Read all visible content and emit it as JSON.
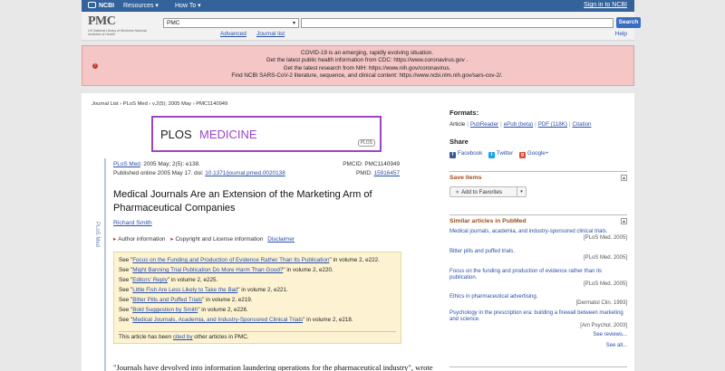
{
  "ncbi_bar": {
    "logo": "NCBI",
    "resources": "Resources ▾",
    "howto": "How To ▾",
    "signin": "Sign in to NCBI"
  },
  "header": {
    "logo": "PMC",
    "subtitle": "US National Library of Medicine National Institutes of Health",
    "db_value": "PMC",
    "search_value": "",
    "search_button": "Search",
    "advanced": "Advanced",
    "journal_list": "Journal list",
    "help": "Help"
  },
  "banner": {
    "lines": [
      "COVID-19 is an emerging, rapidly evolving situation.",
      "Get the latest public health information from CDC: https://www.coronavirus.gov .",
      "Get the latest research from NIH: https://www.nih.gov/coronavirus.",
      "Find NCBI SARS-CoV-2 literature, sequence, and clinical content: https://www.ncbi.nlm.nih.gov/sars-cov-2/."
    ]
  },
  "article": {
    "breadcrumb": "Journal List › PLoS Med › v.2(5); 2005 May › PMC1140949",
    "logo_text_1": "PLOS",
    "logo_text_2": "MEDICINE",
    "logo_badge": "PLOS",
    "side_label": "PLoS Med",
    "journal": "PLoS Med",
    "citation": ". 2005 May; 2(5): e138.",
    "published": "Published online 2005 May 17. doi: ",
    "doi": "10.1371/journal.pmed.0020138",
    "pmcid": "PMCID: PMC1140949",
    "pmid_label": "PMID: ",
    "pmid": "15916457",
    "title": "Medical Journals Are an Extension of the Marketing Arm of Pharmaceutical Companies",
    "author": "Richard Smith",
    "author_info": "Author information",
    "copyright": "Copyright and License information",
    "disclaimer": "Disclaimer",
    "see_also": [
      {
        "pre": "See \"",
        "link": "Focus on the Funding and Production of Evidence Rather Than Its Publication",
        "post": "\" in volume 2, e222."
      },
      {
        "pre": "See \"",
        "link": "Might Banning Trial Publication Do More Harm Than Good?",
        "post": "\" in volume 2, e220."
      },
      {
        "pre": "See \"",
        "link": "Editors' Reply",
        "post": "\" in volume 2, e225."
      },
      {
        "pre": "See \"",
        "link": "Little Fish Are Less Likely to Take the Bait",
        "post": "\" in volume 2, e221."
      },
      {
        "pre": "See \"",
        "link": "Bitter Pills and Puffed Trials",
        "post": "\" in volume 2, e219."
      },
      {
        "pre": "See \"",
        "link": "Bold Suggestion by Smith",
        "post": "\" in volume 2, e226."
      },
      {
        "pre": "See \"",
        "link": "Medical Journals, Academia, and Industry-Sponsored Clinical Trials",
        "post": "\" in volume 2, e218."
      }
    ],
    "cited_pre": "This article has been ",
    "cited_link": "cited by",
    "cited_post": " other articles in PMC.",
    "quote": "\"Journals have devolved into information laundering operations for the pharmaceutical industry\", wrote"
  },
  "right": {
    "formats_title": "Formats:",
    "formats": [
      "Article",
      "PubReader",
      "ePub (beta)",
      "PDF (118K)",
      "Citation"
    ],
    "share_title": "Share",
    "share": [
      "Facebook",
      "Twitter",
      "Google+"
    ],
    "save_title": "Save items",
    "fav_button": "Add to Favorites",
    "similar_title": "Similar articles in PubMed",
    "similar": [
      {
        "title": "Medical journals, academia, and industry-sponsored clinical trials.",
        "source": "[PLoS Med. 2005]"
      },
      {
        "title": "Bitter pills and puffed trials.",
        "source": "[PLoS Med. 2005]"
      },
      {
        "title": "Focus on the funding and production of evidence rather than its publication.",
        "source": "[PLoS Med. 2005]"
      },
      {
        "title": "Ethics in pharmaceutical advertising.",
        "source": "[Dermatol Clin. 1993]"
      },
      {
        "title": "Psychology in the prescription era: building a firewall between marketing and science.",
        "source": "[Am Psychol. 2003]"
      }
    ],
    "see_reviews": "See reviews...",
    "see_all": "See all..."
  }
}
